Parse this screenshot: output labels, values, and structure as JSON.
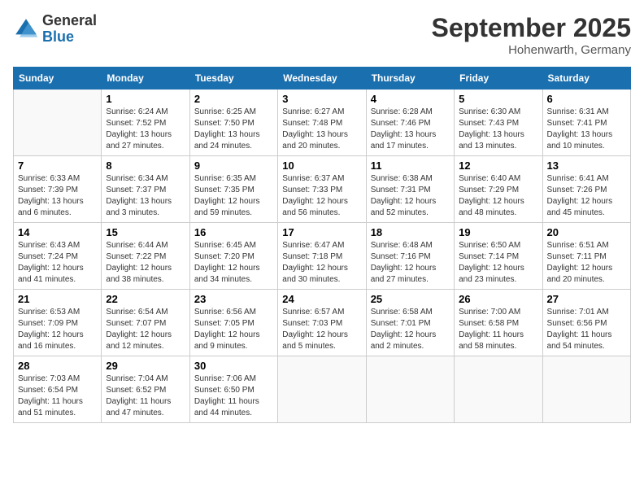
{
  "logo": {
    "general": "General",
    "blue": "Blue"
  },
  "title": "September 2025",
  "location": "Hohenwarth, Germany",
  "weekdays": [
    "Sunday",
    "Monday",
    "Tuesday",
    "Wednesday",
    "Thursday",
    "Friday",
    "Saturday"
  ],
  "weeks": [
    [
      {
        "day": "",
        "info": ""
      },
      {
        "day": "1",
        "info": "Sunrise: 6:24 AM\nSunset: 7:52 PM\nDaylight: 13 hours\nand 27 minutes."
      },
      {
        "day": "2",
        "info": "Sunrise: 6:25 AM\nSunset: 7:50 PM\nDaylight: 13 hours\nand 24 minutes."
      },
      {
        "day": "3",
        "info": "Sunrise: 6:27 AM\nSunset: 7:48 PM\nDaylight: 13 hours\nand 20 minutes."
      },
      {
        "day": "4",
        "info": "Sunrise: 6:28 AM\nSunset: 7:46 PM\nDaylight: 13 hours\nand 17 minutes."
      },
      {
        "day": "5",
        "info": "Sunrise: 6:30 AM\nSunset: 7:43 PM\nDaylight: 13 hours\nand 13 minutes."
      },
      {
        "day": "6",
        "info": "Sunrise: 6:31 AM\nSunset: 7:41 PM\nDaylight: 13 hours\nand 10 minutes."
      }
    ],
    [
      {
        "day": "7",
        "info": "Sunrise: 6:33 AM\nSunset: 7:39 PM\nDaylight: 13 hours\nand 6 minutes."
      },
      {
        "day": "8",
        "info": "Sunrise: 6:34 AM\nSunset: 7:37 PM\nDaylight: 13 hours\nand 3 minutes."
      },
      {
        "day": "9",
        "info": "Sunrise: 6:35 AM\nSunset: 7:35 PM\nDaylight: 12 hours\nand 59 minutes."
      },
      {
        "day": "10",
        "info": "Sunrise: 6:37 AM\nSunset: 7:33 PM\nDaylight: 12 hours\nand 56 minutes."
      },
      {
        "day": "11",
        "info": "Sunrise: 6:38 AM\nSunset: 7:31 PM\nDaylight: 12 hours\nand 52 minutes."
      },
      {
        "day": "12",
        "info": "Sunrise: 6:40 AM\nSunset: 7:29 PM\nDaylight: 12 hours\nand 48 minutes."
      },
      {
        "day": "13",
        "info": "Sunrise: 6:41 AM\nSunset: 7:26 PM\nDaylight: 12 hours\nand 45 minutes."
      }
    ],
    [
      {
        "day": "14",
        "info": "Sunrise: 6:43 AM\nSunset: 7:24 PM\nDaylight: 12 hours\nand 41 minutes."
      },
      {
        "day": "15",
        "info": "Sunrise: 6:44 AM\nSunset: 7:22 PM\nDaylight: 12 hours\nand 38 minutes."
      },
      {
        "day": "16",
        "info": "Sunrise: 6:45 AM\nSunset: 7:20 PM\nDaylight: 12 hours\nand 34 minutes."
      },
      {
        "day": "17",
        "info": "Sunrise: 6:47 AM\nSunset: 7:18 PM\nDaylight: 12 hours\nand 30 minutes."
      },
      {
        "day": "18",
        "info": "Sunrise: 6:48 AM\nSunset: 7:16 PM\nDaylight: 12 hours\nand 27 minutes."
      },
      {
        "day": "19",
        "info": "Sunrise: 6:50 AM\nSunset: 7:14 PM\nDaylight: 12 hours\nand 23 minutes."
      },
      {
        "day": "20",
        "info": "Sunrise: 6:51 AM\nSunset: 7:11 PM\nDaylight: 12 hours\nand 20 minutes."
      }
    ],
    [
      {
        "day": "21",
        "info": "Sunrise: 6:53 AM\nSunset: 7:09 PM\nDaylight: 12 hours\nand 16 minutes."
      },
      {
        "day": "22",
        "info": "Sunrise: 6:54 AM\nSunset: 7:07 PM\nDaylight: 12 hours\nand 12 minutes."
      },
      {
        "day": "23",
        "info": "Sunrise: 6:56 AM\nSunset: 7:05 PM\nDaylight: 12 hours\nand 9 minutes."
      },
      {
        "day": "24",
        "info": "Sunrise: 6:57 AM\nSunset: 7:03 PM\nDaylight: 12 hours\nand 5 minutes."
      },
      {
        "day": "25",
        "info": "Sunrise: 6:58 AM\nSunset: 7:01 PM\nDaylight: 12 hours\nand 2 minutes."
      },
      {
        "day": "26",
        "info": "Sunrise: 7:00 AM\nSunset: 6:58 PM\nDaylight: 11 hours\nand 58 minutes."
      },
      {
        "day": "27",
        "info": "Sunrise: 7:01 AM\nSunset: 6:56 PM\nDaylight: 11 hours\nand 54 minutes."
      }
    ],
    [
      {
        "day": "28",
        "info": "Sunrise: 7:03 AM\nSunset: 6:54 PM\nDaylight: 11 hours\nand 51 minutes."
      },
      {
        "day": "29",
        "info": "Sunrise: 7:04 AM\nSunset: 6:52 PM\nDaylight: 11 hours\nand 47 minutes."
      },
      {
        "day": "30",
        "info": "Sunrise: 7:06 AM\nSunset: 6:50 PM\nDaylight: 11 hours\nand 44 minutes."
      },
      {
        "day": "",
        "info": ""
      },
      {
        "day": "",
        "info": ""
      },
      {
        "day": "",
        "info": ""
      },
      {
        "day": "",
        "info": ""
      }
    ]
  ]
}
